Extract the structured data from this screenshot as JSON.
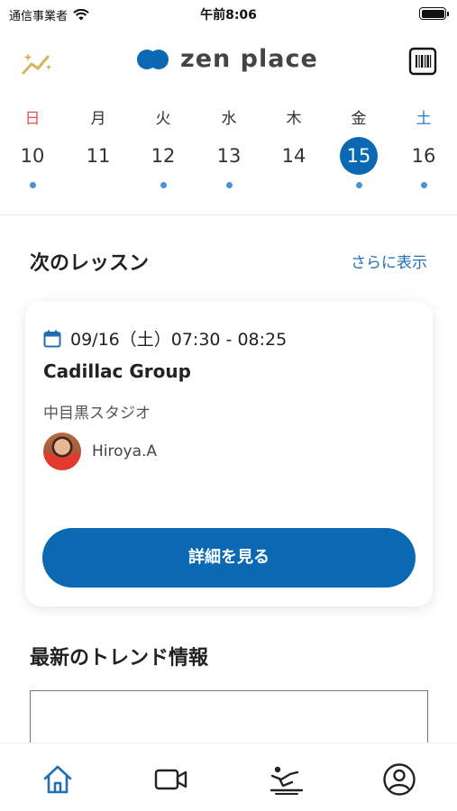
{
  "status_bar": {
    "carrier": "通信事業者",
    "time": "午前8:06"
  },
  "header": {
    "logo_text": "zen place",
    "brand_color": "#0b68b3",
    "left_icon": "trend-sparkle-icon",
    "right_icon": "barcode-icon"
  },
  "week": [
    {
      "dow": "日",
      "date": "10",
      "has_dot": true,
      "color": "#e2534a"
    },
    {
      "dow": "月",
      "date": "11",
      "has_dot": false
    },
    {
      "dow": "火",
      "date": "12",
      "has_dot": true
    },
    {
      "dow": "水",
      "date": "13",
      "has_dot": true
    },
    {
      "dow": "木",
      "date": "14",
      "has_dot": false
    },
    {
      "dow": "金",
      "date": "15",
      "has_dot": true,
      "selected": true
    },
    {
      "dow": "土",
      "date": "16",
      "has_dot": true,
      "color": "#2c78c4"
    }
  ],
  "next_lesson": {
    "title": "次のレッスン",
    "see_more": "さらに表示",
    "card": {
      "datetime": "09/16（土）07:30 - 08:25",
      "class_name": "Cadillac Group",
      "studio": "中目黒スタジオ",
      "instructor": "Hiroya.A",
      "button_label": "詳細を見る"
    }
  },
  "trends": {
    "title": "最新のトレンド情報"
  },
  "tabs": [
    {
      "icon": "home-icon",
      "active": true
    },
    {
      "icon": "video-icon",
      "active": false
    },
    {
      "icon": "pilates-machine-icon",
      "active": false
    },
    {
      "icon": "profile-icon",
      "active": false
    }
  ]
}
